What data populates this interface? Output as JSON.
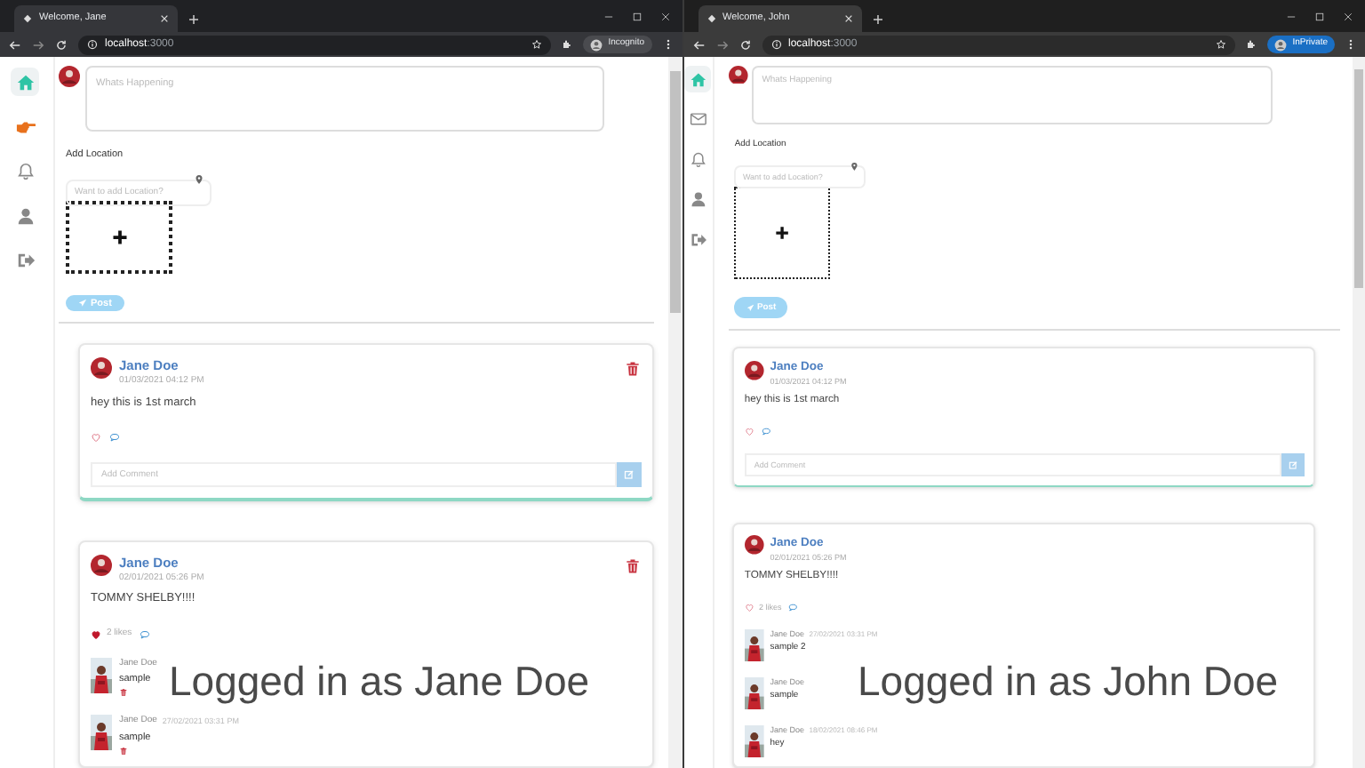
{
  "windows": [
    {
      "kind": "chrome",
      "tab_title": "Welcome, Jane",
      "url_host": "localhost",
      "url_port": ":3000",
      "profile_label": "Incognito",
      "sidebar": [
        {
          "kind": "home",
          "selected": true
        },
        {
          "kind": "pointer",
          "selected": false
        },
        {
          "kind": "bell",
          "selected": false
        },
        {
          "kind": "user",
          "selected": false
        },
        {
          "kind": "logout",
          "selected": false
        }
      ],
      "composer": {
        "placeholder": "Whats Happening",
        "location_label": "Add Location",
        "location_placeholder": "Want to add Location?",
        "post_button": "Post"
      },
      "posts": [
        {
          "author": "Jane Doe",
          "time": "01/03/2021 04:12 PM",
          "text": "hey this is 1st march",
          "deletable": true,
          "liked": false,
          "comment_placeholder": "Add Comment"
        },
        {
          "author": "Jane Doe",
          "time": "02/01/2021 05:26 PM",
          "text": "TOMMY SHELBY!!!!",
          "deletable": true,
          "liked": true,
          "likes": "2 likes",
          "comments": [
            {
              "author": "Jane Doe",
              "text": "sample",
              "deletable": true
            },
            {
              "author": "Jane Doe",
              "time": "27/02/2021 03:31 PM",
              "text": "sample",
              "deletable": true
            }
          ]
        }
      ],
      "caption": "Logged in as Jane Doe"
    },
    {
      "kind": "edge",
      "tab_title": "Welcome, John",
      "url_host": "localhost",
      "url_port": ":3000",
      "profile_label": "InPrivate",
      "sidebar": [
        {
          "kind": "home",
          "selected": true
        },
        {
          "kind": "mail",
          "selected": false
        },
        {
          "kind": "bell",
          "selected": false
        },
        {
          "kind": "user",
          "selected": false
        },
        {
          "kind": "logout",
          "selected": false
        }
      ],
      "composer": {
        "placeholder": "Whats Happening",
        "location_label": "Add Location",
        "location_placeholder": "Want to add Location?",
        "post_button": "Post"
      },
      "posts": [
        {
          "author": "Jane Doe",
          "time": "01/03/2021 04:12 PM",
          "text": "hey this is 1st march",
          "deletable": false,
          "liked": false,
          "comment_placeholder": "Add Comment"
        },
        {
          "author": "Jane Doe",
          "time": "02/01/2021 05:26 PM",
          "text": "TOMMY SHELBY!!!!",
          "deletable": false,
          "liked": false,
          "likes": "2 likes",
          "comments": [
            {
              "author": "Jane Doe",
              "time": "27/02/2021 03:31 PM",
              "text": "sample 2",
              "deletable": false
            },
            {
              "author": "Jane Doe",
              "text": "sample",
              "deletable": false
            },
            {
              "author": "Jane Doe",
              "time": "18/02/2021 08:46 PM",
              "text": "hey",
              "deletable": false
            }
          ]
        }
      ],
      "caption": "Logged in as John Doe"
    }
  ]
}
